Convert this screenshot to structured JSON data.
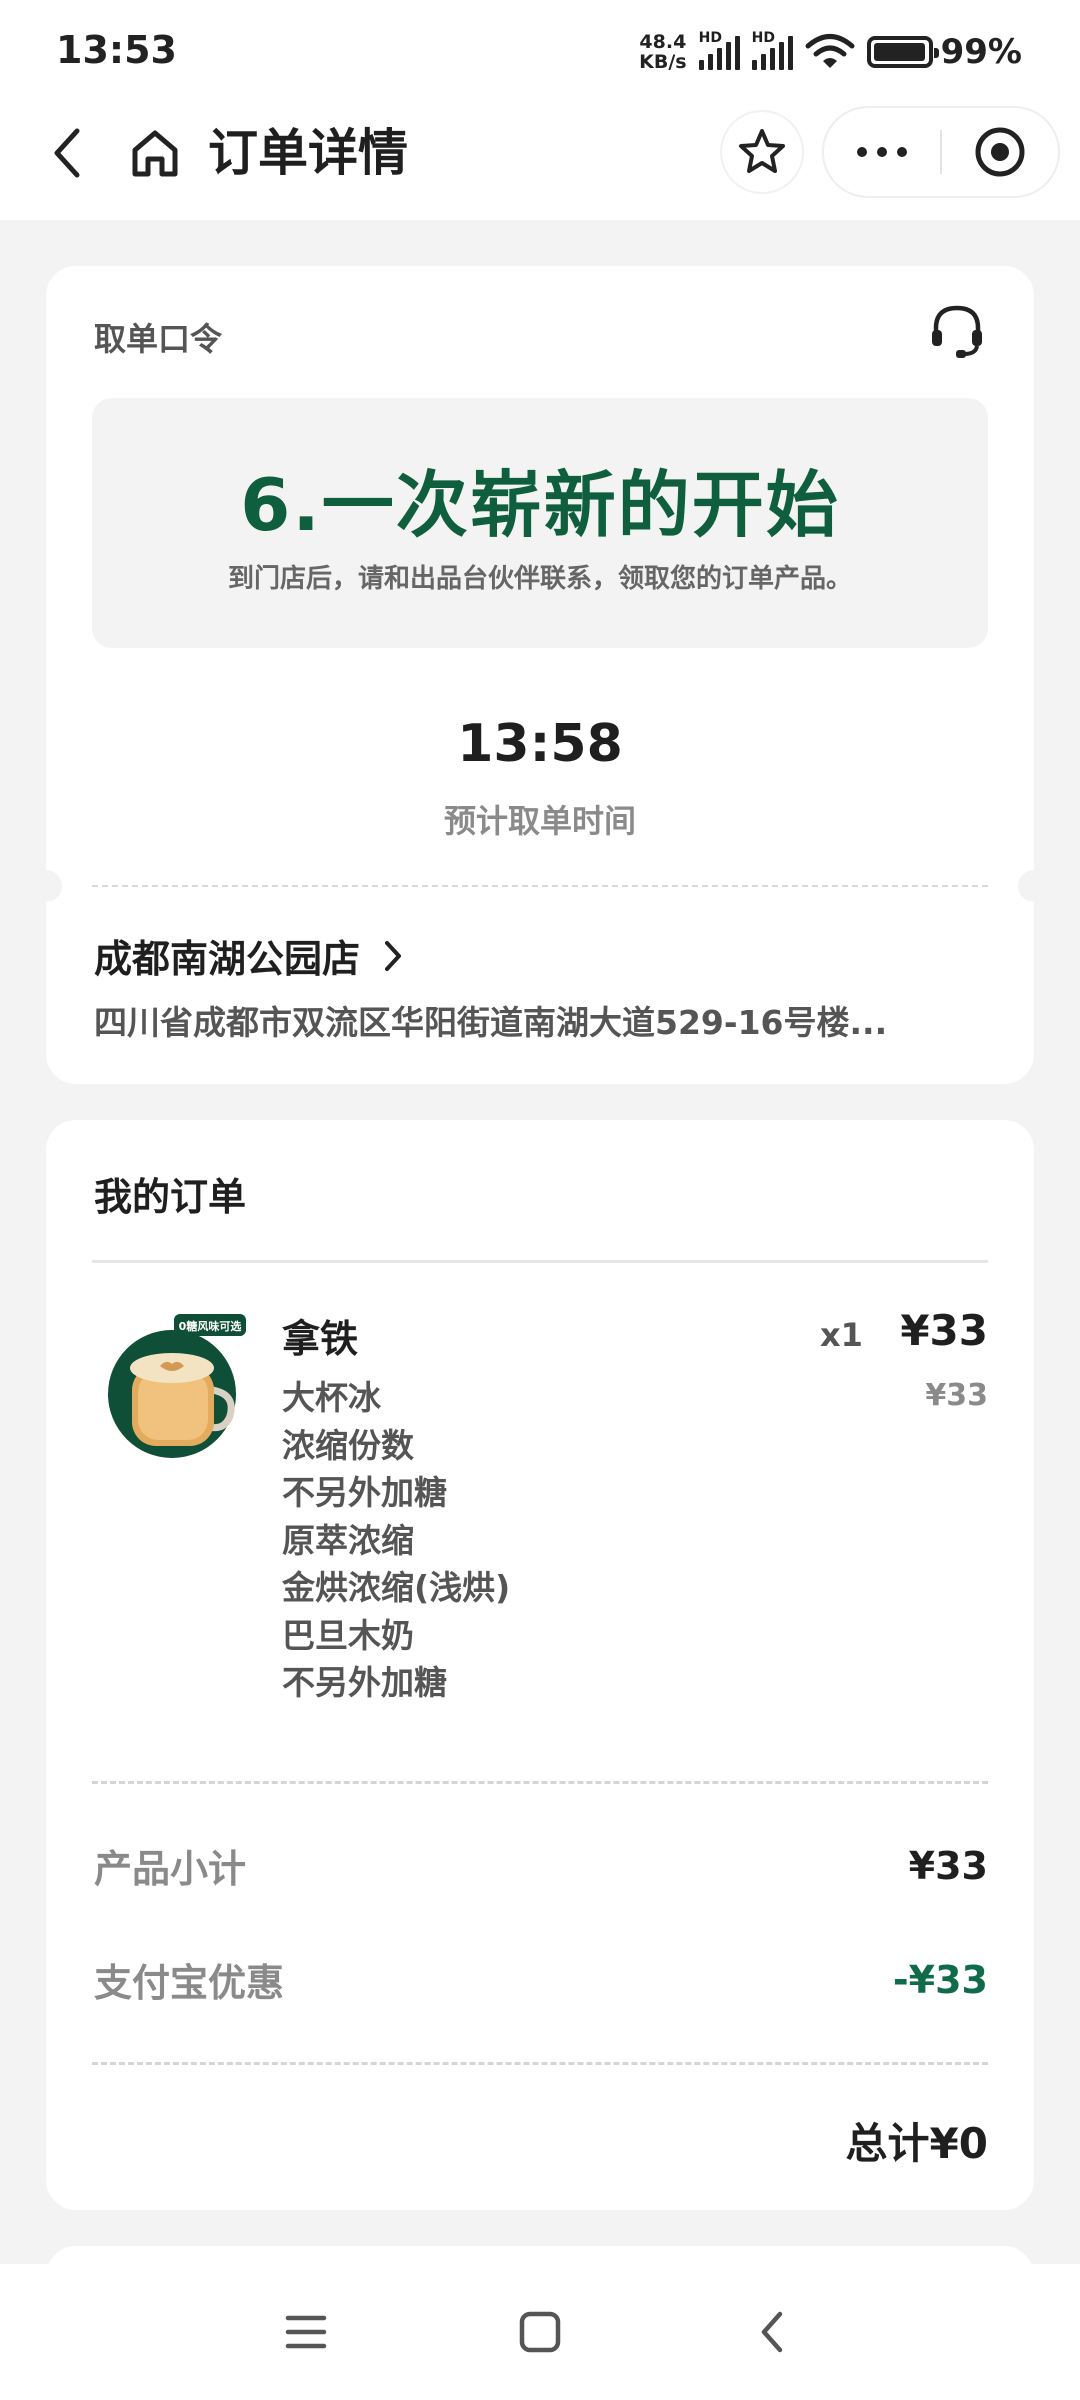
{
  "status_bar": {
    "time": "13:53",
    "net_speed_value": "48.4",
    "net_speed_unit": "KB/s",
    "sim1_label": "HD",
    "sim2_label": "HD",
    "battery_text": "99%",
    "battery_level": 0.99
  },
  "nav": {
    "title": "订单详情",
    "icons": [
      "chevron-left-icon",
      "home-icon",
      "star-icon",
      "more-icon",
      "close-target-icon"
    ]
  },
  "pickup": {
    "label": "取单口令",
    "code": "6.一次崭新的开始",
    "tip": "到门店后，请和出品台伙伴联系，领取您的订单产品。",
    "time": "13:58",
    "time_label": "预计取单时间",
    "icon": "headset-icon"
  },
  "store": {
    "name": "成都南湖公园店",
    "address": "四川省成都市双流区华阳街道南湖大道529-16号楼..."
  },
  "order": {
    "title": "我的订单",
    "item": {
      "image_badge": "0糖风味可选",
      "name": "拿铁",
      "qty": "x1",
      "price": "¥33",
      "unit_price": "¥33",
      "options": [
        "大杯冰",
        "浓缩份数",
        "不另外加糖",
        "原萃浓缩",
        "金烘浓缩(浅烘)",
        "巴旦木奶",
        "不另外加糖"
      ]
    },
    "subtotal_label": "产品小计",
    "subtotal_value": "¥33",
    "discount_label": "支付宝优惠",
    "discount_value": "-¥33",
    "total": "总计¥0"
  },
  "colors": {
    "brand_green": "#0f5e3e",
    "discount_green": "#0f6b4a",
    "background": "#f3f3f3"
  }
}
